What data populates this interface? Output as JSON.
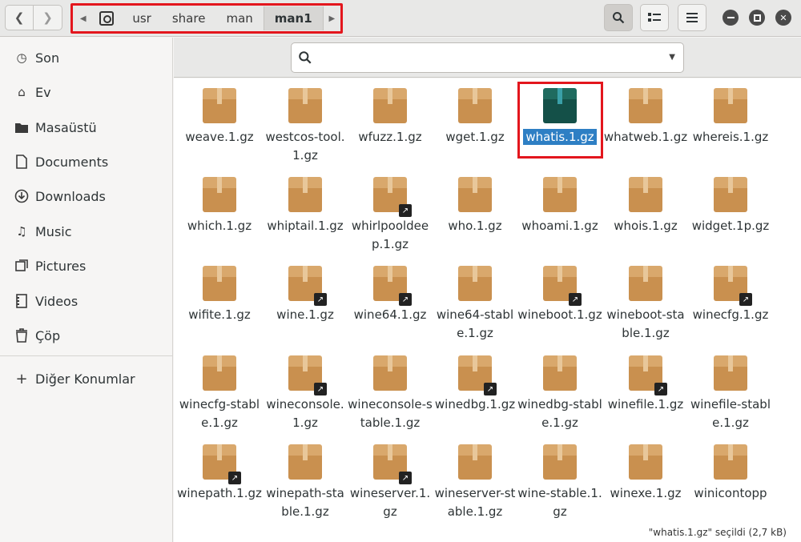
{
  "nav": {
    "back_icon": "chevron-left-icon",
    "forward_icon": "chevron-right-icon"
  },
  "path": {
    "crumbs": [
      "usr",
      "share",
      "man",
      "man1"
    ]
  },
  "sidebar": {
    "items": [
      {
        "label": "Son",
        "icon": "recent-icon"
      },
      {
        "label": "Ev",
        "icon": "home-icon"
      },
      {
        "label": "Masaüstü",
        "icon": "desktop-folder-icon"
      },
      {
        "label": "Documents",
        "icon": "document-icon"
      },
      {
        "label": "Downloads",
        "icon": "download-icon"
      },
      {
        "label": "Music",
        "icon": "music-icon"
      },
      {
        "label": "Pictures",
        "icon": "pictures-icon"
      },
      {
        "label": "Videos",
        "icon": "videos-icon"
      },
      {
        "label": "Çöp",
        "icon": "trash-icon"
      }
    ],
    "other": {
      "label": "Diğer Konumlar",
      "icon": "plus-icon"
    }
  },
  "search": {
    "value": ""
  },
  "files": [
    {
      "name": "weave.1.gz",
      "link": false
    },
    {
      "name": "westcos-tool.1.gz",
      "link": false
    },
    {
      "name": "wfuzz.1.gz",
      "link": false
    },
    {
      "name": "wget.1.gz",
      "link": false
    },
    {
      "name": "whatis.1.gz",
      "link": false,
      "selected": true
    },
    {
      "name": "whatweb.1.gz",
      "link": false
    },
    {
      "name": "whereis.1.gz",
      "link": false
    },
    {
      "name": "which.1.gz",
      "link": false
    },
    {
      "name": "whiptail.1.gz",
      "link": false
    },
    {
      "name": "whirlpooldeep.1.gz",
      "link": true
    },
    {
      "name": "who.1.gz",
      "link": false
    },
    {
      "name": "whoami.1.gz",
      "link": false
    },
    {
      "name": "whois.1.gz",
      "link": false
    },
    {
      "name": "widget.1p.gz",
      "link": false
    },
    {
      "name": "wifite.1.gz",
      "link": false
    },
    {
      "name": "wine.1.gz",
      "link": true
    },
    {
      "name": "wine64.1.gz",
      "link": true
    },
    {
      "name": "wine64-stable.1.gz",
      "link": false
    },
    {
      "name": "wineboot.1.gz",
      "link": true
    },
    {
      "name": "wineboot-stable.1.gz",
      "link": false
    },
    {
      "name": "winecfg.1.gz",
      "link": true
    },
    {
      "name": "winecfg-stable.1.gz",
      "link": false
    },
    {
      "name": "wineconsole.1.gz",
      "link": true
    },
    {
      "name": "wineconsole-stable.1.gz",
      "link": false
    },
    {
      "name": "winedbg.1.gz",
      "link": true
    },
    {
      "name": "winedbg-stable.1.gz",
      "link": false
    },
    {
      "name": "winefile.1.gz",
      "link": true
    },
    {
      "name": "winefile-stable.1.gz",
      "link": false
    },
    {
      "name": "winepath.1.gz",
      "link": true
    },
    {
      "name": "winepath-stable.1.gz",
      "link": false
    },
    {
      "name": "wineserver.1.gz",
      "link": true
    },
    {
      "name": "wineserver-stable.1.gz",
      "link": false
    },
    {
      "name": "wine-stable.1.gz",
      "link": false
    },
    {
      "name": "winexe.1.gz",
      "link": false
    },
    {
      "name": "winicontopp",
      "link": false
    }
  ],
  "status": {
    "text": "\"whatis.1.gz\" seçildi  (2,7 kB)"
  },
  "colors": {
    "selection": "#2e7fc4",
    "highlight_box": "#e3161d",
    "package": "#c9904f"
  }
}
